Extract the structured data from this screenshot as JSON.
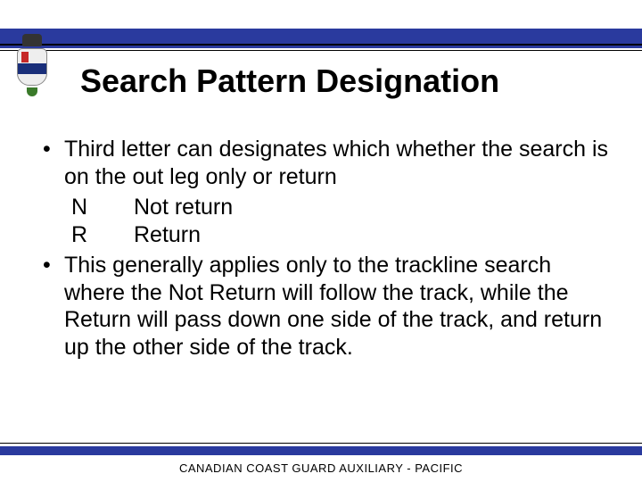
{
  "title": "Search Pattern Designation",
  "bullets": {
    "b1": "Third letter can designates which whether the search is on the out leg only or return",
    "defs": {
      "n_code": "N",
      "n_label": "Not return",
      "r_code": "R",
      "r_label": "Return"
    },
    "b2": "This generally applies only to the trackline search where the Not Return will follow the track, while the Return will pass down one side of the track, and return up the other side of the track."
  },
  "footer": "CANADIAN COAST GUARD AUXILIARY - PACIFIC",
  "logo_name": "ccga-crest"
}
